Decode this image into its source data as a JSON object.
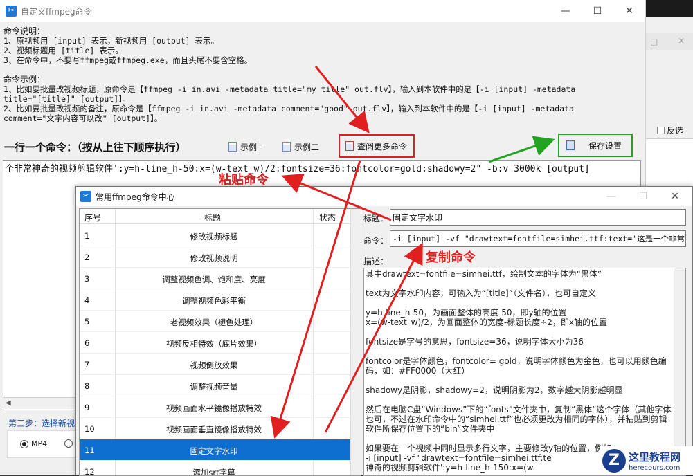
{
  "main_window": {
    "title": "自定义ffmpeg命令",
    "icon": "ffmpeg-app-icon",
    "help_lines": [
      "命令说明：",
      "1、原视频用 [input] 表示，新视频用 [output] 表示。",
      "2、视频标题用 [title] 表示。",
      "3、在命令中，不要写ffmpeg或ffmpeg.exe，而且头尾不要含空格。",
      "",
      "命令示例：",
      "1、比如要批量改视频标题，原命令是【ffmpeg -i in.avi -metadata title=\"my title\" out.flv】，输入到本软件中的是【-i [input] -metadata",
      "title=\"[title]\" [output]】。",
      "2、比如要批量改视频的备注，原命令是【ffmpeg -i in.avi -metadata comment=\"good\" out.flv】，输入到本软件中的是【-i [input] -metadata",
      "comment=\"文字内容可以改\" [output]】。"
    ],
    "command_label": "一行一个命令：（按从上往下顺序执行）",
    "example1_label": "示例一",
    "example2_label": "示例二",
    "more_commands_label": "查阅更多命令",
    "save_label": "保存设置",
    "command_text": "个非常神奇的视频剪辑软件':y=h-line_h-50:x=(w-text_w)/2:fontsize=36:fontcolor=gold:shadowy=2\" -b:v 3000k [output]",
    "step3_label": "第三步：选择新视",
    "format_options": [
      "MP4",
      ""
    ],
    "format_selected": "MP4"
  },
  "background_window": {
    "checkbox_label": "反选"
  },
  "dialog": {
    "title": "常用ffmpeg命令中心",
    "columns": [
      "序号",
      "标题",
      "状态"
    ],
    "rows": [
      {
        "no": "1",
        "title": "修改视频标题"
      },
      {
        "no": "2",
        "title": "修改视频说明"
      },
      {
        "no": "3",
        "title": "调整视频色调、饱和度、亮度"
      },
      {
        "no": "4",
        "title": "调整视频色彩平衡"
      },
      {
        "no": "5",
        "title": "老视频效果（褪色处理）"
      },
      {
        "no": "6",
        "title": "视频反相特效（底片效果）"
      },
      {
        "no": "7",
        "title": "视频倒放效果"
      },
      {
        "no": "8",
        "title": "调整视频音量"
      },
      {
        "no": "9",
        "title": "视频画面水平镜像播放特效"
      },
      {
        "no": "10",
        "title": "视频画面垂直镜像播放特效"
      },
      {
        "no": "11",
        "title": "固定文字水印"
      },
      {
        "no": "12",
        "title": "添加srt字幕"
      }
    ],
    "selected_index": 10,
    "title_label": "标题：",
    "title_value": "固定文字水印",
    "command_label": "命令：",
    "command_value": "-i [input] -vf \"drawtext=fontfile=simhei.ttf:text='这是一个非常神奇的视",
    "desc_label": "描述：",
    "desc_paragraphs": [
      "其中drawtext=fontfile=simhei.ttf，绘制文本的字体为“黑体”",
      "text为文字水印内容，可输入为“[title]”（文件名），也可自定义",
      "y=h-line_h-50，为画面整体的高度-50，即y轴的位置\nx=(w-text_w)/2，为画面整体的宽度-标题长度÷2，即x轴的位置",
      "fontsize是字号的意思，fontsize=36，说明字体大小为36",
      "fontcolor是字体颜色，fontcolor= gold，说明字体颜色为金色，也可以用颜色编码，如：#FF0000（大红）",
      "shadowy是阴影，shadowy=2，说明阴影为2，数字越大阴影越明显",
      "然后在电脑C盘“Windows”下的“fonts”文件夹中，复制“黑体”这个字体（其他字体也可，不过在水印命令中的“simhei.ttf”也必须更改为相同的字体），并粘贴到剪辑软件所保存位置下的“bin”文件夹中",
      "如果要在一个视频中同时显示多行文字，主要修改y轴的位置，例如\n-i [input] -vf \"drawtext=fontfile=simhei.ttf:te\n神奇的视频剪辑软件':y=h-line_h-150:x=(w-"
    ]
  },
  "annotations": {
    "paste_label": "粘贴命令",
    "copy_label": "复制命令",
    "color": "#e02020",
    "green": "#22a422"
  },
  "watermark": {
    "logo_letter": "Z",
    "site_name": "这里教程网",
    "site_url": "herecours.com"
  }
}
